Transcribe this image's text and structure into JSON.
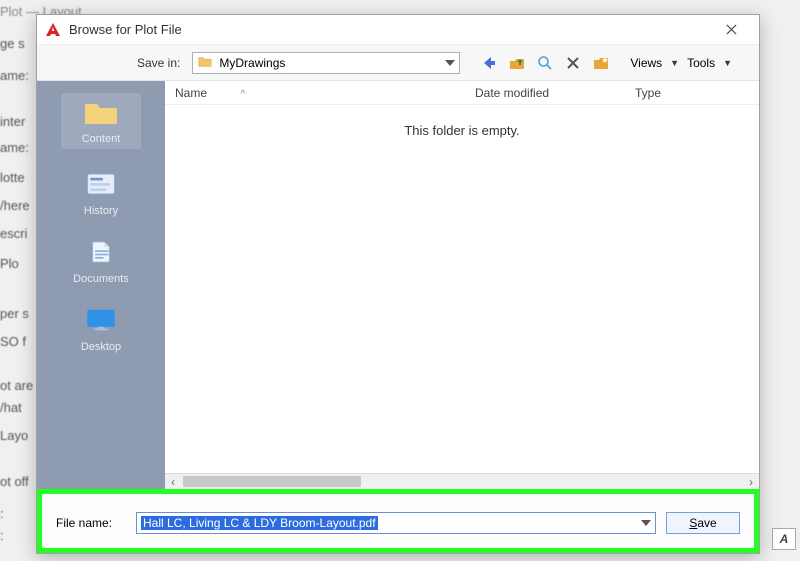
{
  "bg": {
    "labels": [
      "ge s",
      "ame:",
      "inter",
      "ame:",
      "lotte",
      "/here",
      "escri",
      "Plo",
      "per s",
      "SO f",
      "ot are",
      "/hat",
      "Layo",
      "ot off",
      ":",
      ":"
    ],
    "top_title": "Plot — Layout"
  },
  "dialog": {
    "title": "Browse for Plot File",
    "save_in_label": "Save in:",
    "location": "MyDrawings",
    "views_label": "Views",
    "tools_label": "Tools"
  },
  "columns": {
    "name": "Name",
    "date": "Date modified",
    "type": "Type",
    "sort_indicator": "^"
  },
  "list": {
    "empty_msg": "This folder is empty."
  },
  "sidebar": {
    "items": [
      {
        "label": "Content"
      },
      {
        "label": "History"
      },
      {
        "label": "Documents"
      },
      {
        "label": "Desktop"
      }
    ]
  },
  "file": {
    "label": "File name:",
    "value": "Hall LC, Living LC & LDY Broom-Layout.pdf",
    "save_label": "Save",
    "save_underline": "S"
  },
  "side_button": "A"
}
